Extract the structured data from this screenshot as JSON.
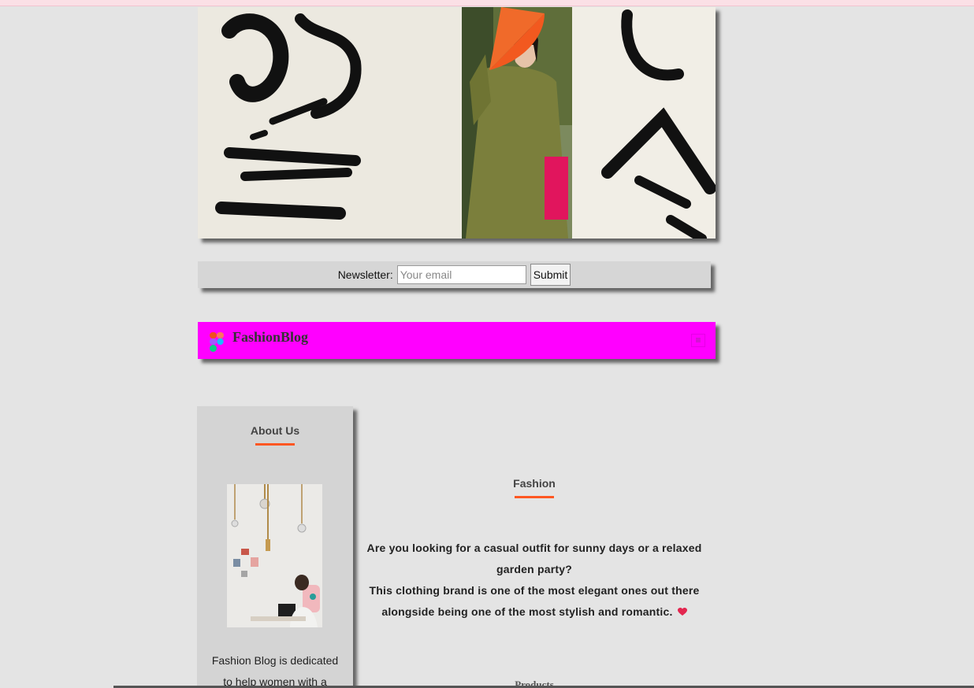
{
  "newsletter": {
    "label": "Newsletter:",
    "email_placeholder": "Your email",
    "submit_label": "Submit"
  },
  "navbar": {
    "brand": "FashionBlog",
    "menu_icon": "hamburger-icon",
    "background_color": "#ff00ff"
  },
  "sidebar": {
    "title": "About Us",
    "text": "Fashion Blog is dedicated to help women with a"
  },
  "main": {
    "title": "Fashion",
    "paragraph_1": "Are you looking for a casual outfit for sunny days or a relaxed garden party?",
    "paragraph_2": "This clothing brand is one of the most elegant ones out there alongside being one of the most stylish and romantic.",
    "heart_icon": "heart-icon",
    "products_heading": "Products"
  },
  "colors": {
    "accent_underline": "#ff5722",
    "page_background": "#e4e4e4",
    "panel_background": "#d4d4d4"
  }
}
